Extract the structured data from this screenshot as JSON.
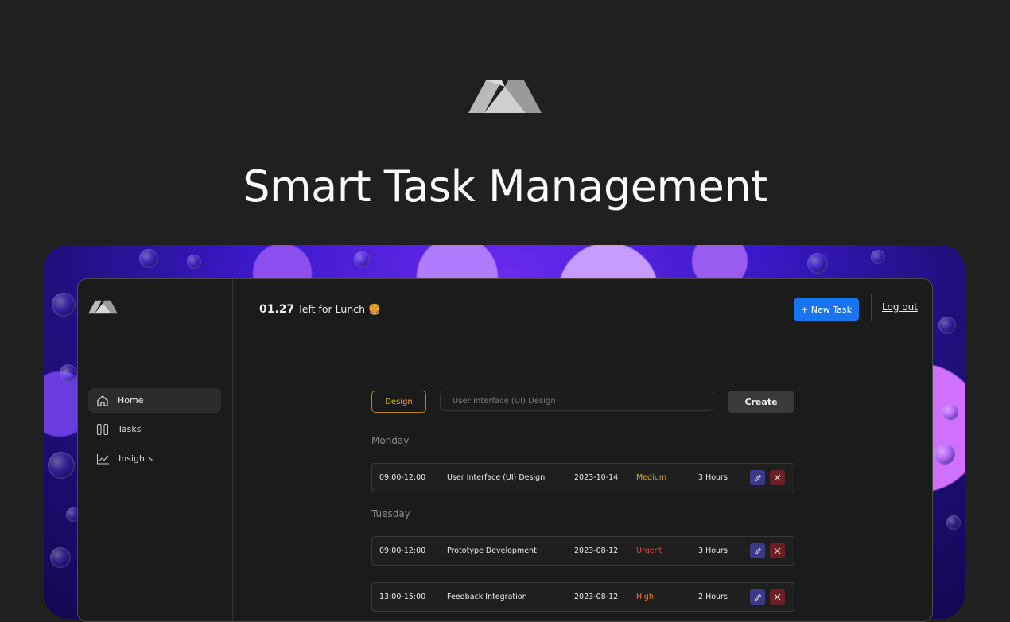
{
  "hero": {
    "title": "Smart Task Management"
  },
  "topbar": {
    "timer_value": "01.27",
    "timer_text": "left for Lunch",
    "timer_emoji": "🍔",
    "new_task_label": "+ New Task",
    "logout_label": "Log out"
  },
  "sidebar": {
    "items": [
      {
        "label": "Home",
        "icon": "home-icon",
        "active": true
      },
      {
        "label": "Tasks",
        "icon": "columns-icon",
        "active": false
      },
      {
        "label": "Insights",
        "icon": "chart-line-icon",
        "active": false
      }
    ]
  },
  "composer": {
    "tag_label": "Design",
    "input_placeholder": "User Interface (UI) Design",
    "create_label": "Create"
  },
  "days": [
    {
      "name": "Monday",
      "tasks": [
        {
          "time": "09:00-12:00",
          "name": "User Interface (UI) Design",
          "date": "2023-10-14",
          "priority": "Medium",
          "duration": "3 Hours"
        }
      ]
    },
    {
      "name": "Tuesday",
      "tasks": [
        {
          "time": "09:00-12:00",
          "name": "Prototype Development",
          "date": "2023-08-12",
          "priority": "Urgent",
          "duration": "3 Hours"
        },
        {
          "time": "13:00-15:00",
          "name": "Feedback Integration",
          "date": "2023-08-12",
          "priority": "High",
          "duration": "2 Hours"
        }
      ]
    }
  ],
  "colors": {
    "accent": "#1a74f0",
    "priority_medium": "#e1a92b",
    "priority_urgent": "#e0454a",
    "priority_high": "#f07a2a"
  }
}
